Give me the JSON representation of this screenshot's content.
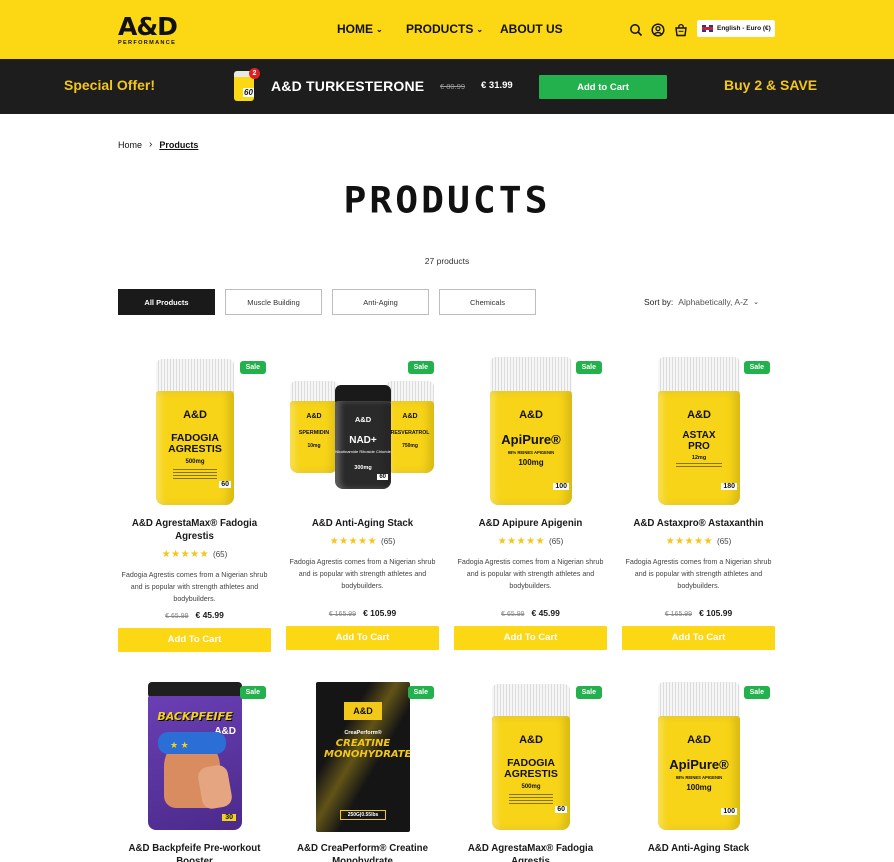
{
  "header": {
    "logo_text": "A&D",
    "logo_sub": "PERFORMANCE",
    "nav": [
      {
        "label": "HOME"
      },
      {
        "label": "PRODUCTS"
      },
      {
        "label": "ABOUT US"
      }
    ],
    "language": "English - Euro (€)",
    "icons": [
      "search-icon",
      "account-icon",
      "cart-icon"
    ],
    "color": "#fbd714"
  },
  "promo": {
    "special": "Special Offer!",
    "product_name": "A&D TURKESTERONE",
    "thumb_badge": "60",
    "thumb_count": "2",
    "old_price": "€ 80.99",
    "new_price": "€ 31.99",
    "add_to_cart": "Add to Cart",
    "buy_save": "Buy 2 & SAVE"
  },
  "breadcrumb": {
    "home": "Home",
    "current": "Products"
  },
  "page": {
    "title": "PRODUCTS",
    "count": "27 products"
  },
  "filters": [
    {
      "label": "All Products",
      "active": true
    },
    {
      "label": "Muscle Building",
      "active": false
    },
    {
      "label": "Anti-Aging",
      "active": false
    },
    {
      "label": "Chemicals",
      "active": false
    }
  ],
  "sort": {
    "label": "Sort by:",
    "value": "Alphabetically, A-Z"
  },
  "products": [
    {
      "name": "A&D AgrestaMax® Fadogia Agrestis",
      "sale": "Sale",
      "stars": "★★★★★",
      "reviews": "(65)",
      "description": "Fadogia Agrestis comes from a Nigerian shrub and is popular with strength athletes and bodybuilders.",
      "old_price": "€ 65.99",
      "new_price": "€ 45.99",
      "cta": "Add To Cart",
      "label": {
        "brand": "A&D",
        "name": "FADOGIA AGRESTIS",
        "dose": "500mg",
        "count": "60"
      }
    },
    {
      "name": "A&D Anti-Aging Stack",
      "sale": "Sale",
      "stars": "★★★★★",
      "reviews": "(65)",
      "description": "Fadogia Agrestis comes from a Nigerian shrub and is popular with strength athletes and bodybuilders.",
      "old_price": "€ 165.99",
      "new_price": "€ 105.99",
      "cta": "Add To Cart",
      "label": {
        "left": "SPERMIDIN",
        "left_dose": "10mg",
        "center": "NAD+",
        "center_sub": "Nicotinamide Riboside Chloride",
        "center_dose": "300mg",
        "right": "RESVERATROL",
        "right_dose": "750mg",
        "brand": "A&D",
        "count": "60"
      }
    },
    {
      "name": "A&D Apipure Apigenin",
      "sale": "Sale",
      "stars": "★★★★★",
      "reviews": "(65)",
      "description": "Fadogia Agrestis comes from a Nigerian shrub and is popular with strength athletes and bodybuilders.",
      "old_price": "€ 65.99",
      "new_price": "€ 45.99",
      "cta": "Add To Cart",
      "label": {
        "brand": "A&D",
        "name": "ApiPure®",
        "sub": "98% REINES APIGENIN",
        "dose": "100mg",
        "count": "100"
      }
    },
    {
      "name": "A&D Astaxpro® Astaxanthin",
      "sale": "Sale",
      "stars": "★★★★★",
      "reviews": "(65)",
      "description": "Fadogia Agrestis comes from a Nigerian shrub and is popular with strength athletes and bodybuilders.",
      "old_price": "€ 165.99",
      "new_price": "€ 105.99",
      "cta": "Add To Cart",
      "label": {
        "brand": "A&D",
        "name": "ASTAX PRO",
        "dose": "12mg",
        "count": "180"
      }
    },
    {
      "name": "A&D Backpfeife Pre-workout Booster",
      "sale": "Sale",
      "label": {
        "name": "BACKPFEIFE",
        "brand": "A&D",
        "count": "30"
      }
    },
    {
      "name": "A&D CreaPerform® Creatine Monohydrate",
      "sale": "Sale",
      "label": {
        "brand": "A&D",
        "name": "CREATINE MONOHYDRATE",
        "top": "CreaPerform®",
        "weight": "250G|0.55lbs"
      }
    },
    {
      "name": "A&D AgrestaMax® Fadogia Agrestis",
      "sale": "Sale",
      "label": {
        "brand": "A&D",
        "name": "FADOGIA AGRESTIS",
        "dose": "500mg",
        "count": "60"
      }
    },
    {
      "name": "A&D Anti-Aging Stack",
      "sale": "Sale",
      "label": {
        "brand": "A&D",
        "name": "ApiPure®",
        "sub": "98% REINES APIGENIN",
        "dose": "100mg",
        "count": "100"
      }
    }
  ]
}
